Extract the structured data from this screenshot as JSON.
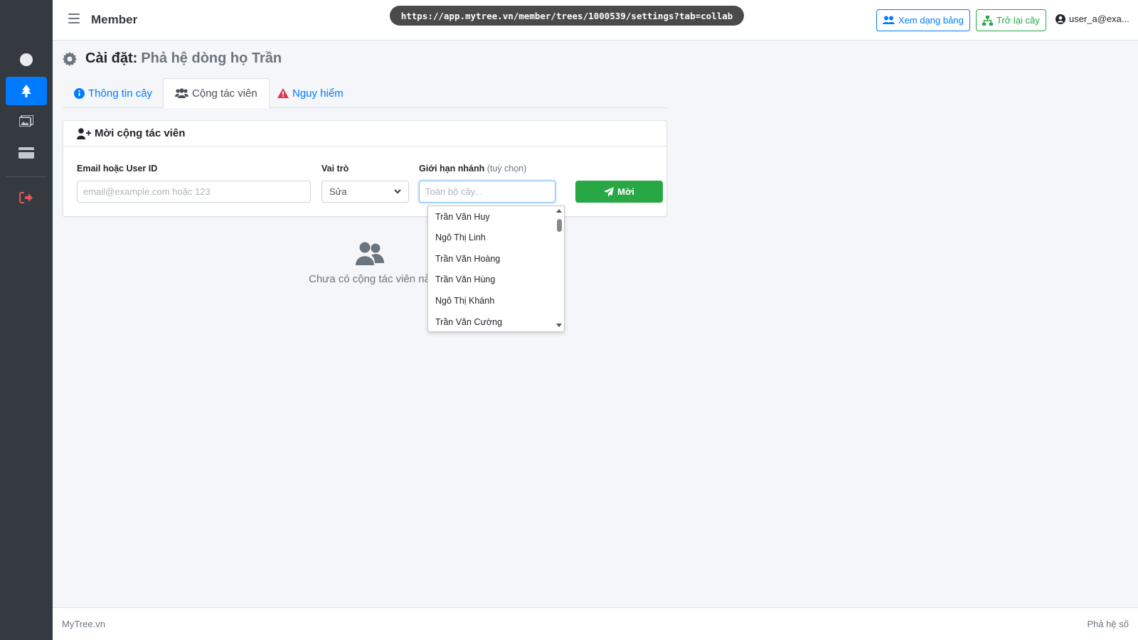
{
  "browser": {
    "url": "https://app.mytree.vn/member/trees/1000539/settings?tab=collab"
  },
  "header": {
    "brand": "Member",
    "table_view_label": "Xem dạng bảng",
    "back_tree_label": "Trở lại cây",
    "user_label": "user_a@exa..."
  },
  "sidebar": {
    "items": [
      {
        "icon": "circle-icon",
        "active": false
      },
      {
        "icon": "tree-icon",
        "active": true
      },
      {
        "icon": "images-icon",
        "active": false
      },
      {
        "icon": "credit-card-icon",
        "active": false
      },
      {
        "icon": "sign-out-icon",
        "active": false
      }
    ]
  },
  "page": {
    "title_label": "Cài đặt:",
    "title_sub": "Phả hệ dòng họ Trần"
  },
  "tabs": [
    {
      "label": "Thông tin cây",
      "icon": "info-circle-icon",
      "active": false
    },
    {
      "label": "Cộng tác viên",
      "icon": "users-icon",
      "active": true
    },
    {
      "label": "Nguy hiểm",
      "icon": "warning-icon",
      "active": false
    }
  ],
  "invite": {
    "title": "Mời cộng tác viên",
    "email_label": "Email hoặc User ID",
    "email_placeholder": "email@example.com hoặc 123",
    "role_label": "Vai trò",
    "role_value": "Sửa",
    "branch_label": "Giới hạn nhánh",
    "branch_optional": "(tuỳ chọn)",
    "branch_placeholder": "Toàn bộ cây...",
    "submit_label": "Mời"
  },
  "branch_options": [
    "Trần Văn Huy",
    "Ngô Thị Linh",
    "Trần Văn Hoàng",
    "Trần Văn Hùng",
    "Ngô Thị Khánh",
    "Trần Văn Cường"
  ],
  "empty_state": {
    "text": "Chưa có cộng tác viên nào"
  },
  "footer": {
    "left": "MyTree.vn",
    "right": "Phả hệ số"
  },
  "colors": {
    "primary": "#007bff",
    "success": "#28a745",
    "danger": "#dc3545",
    "sidebar": "#343a40"
  }
}
